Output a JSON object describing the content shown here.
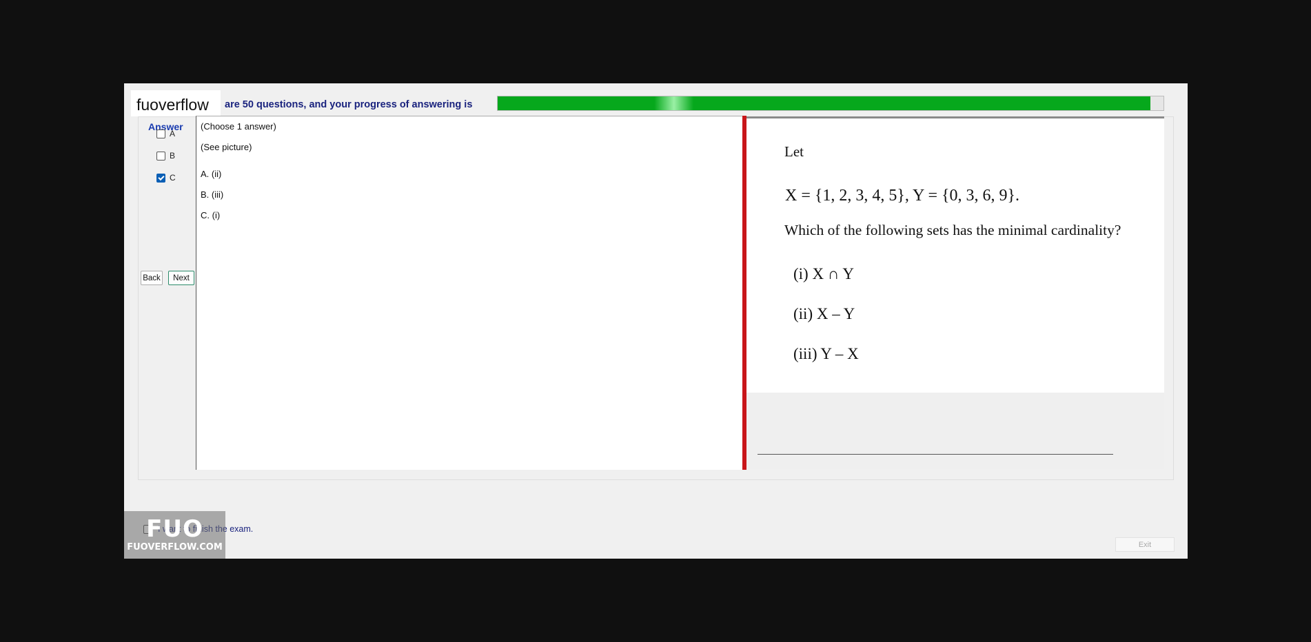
{
  "header": {
    "brand": "fuoverflow",
    "progress_text": "are 50 questions, and your progress of answering is",
    "progress_value": 0.98
  },
  "answer_panel": {
    "title": "Answer",
    "options": [
      {
        "label": "A",
        "checked": false
      },
      {
        "label": "B",
        "checked": false
      },
      {
        "label": "C",
        "checked": true
      }
    ],
    "back_label": "Back",
    "next_label": "Next"
  },
  "question": {
    "instruction": "(Choose 1 answer)",
    "see_picture": "(See picture)",
    "choices": [
      "A.  (ii)",
      "B.  (iii)",
      "C.  (i)"
    ]
  },
  "picture": {
    "line1": "Let",
    "line2": "X = {1, 2, 3, 4, 5}, Y = {0, 3, 6, 9}.",
    "line3": "Which of the following sets has the minimal cardinality?",
    "item1": "(i) X ∩ Y",
    "item2": "(ii) X – Y",
    "item3": "(iii) Y – X"
  },
  "footer": {
    "finish_label": "I want to finish the exam.",
    "exit_label": "Exit",
    "stamp_big": "FUO",
    "stamp_small": "FUOVERFLOW.COM"
  },
  "colors": {
    "progress": "#06a81c",
    "divider": "#c8161a",
    "checkbox_checked": "#0b5fb5",
    "label_blue": "#1a237e"
  }
}
